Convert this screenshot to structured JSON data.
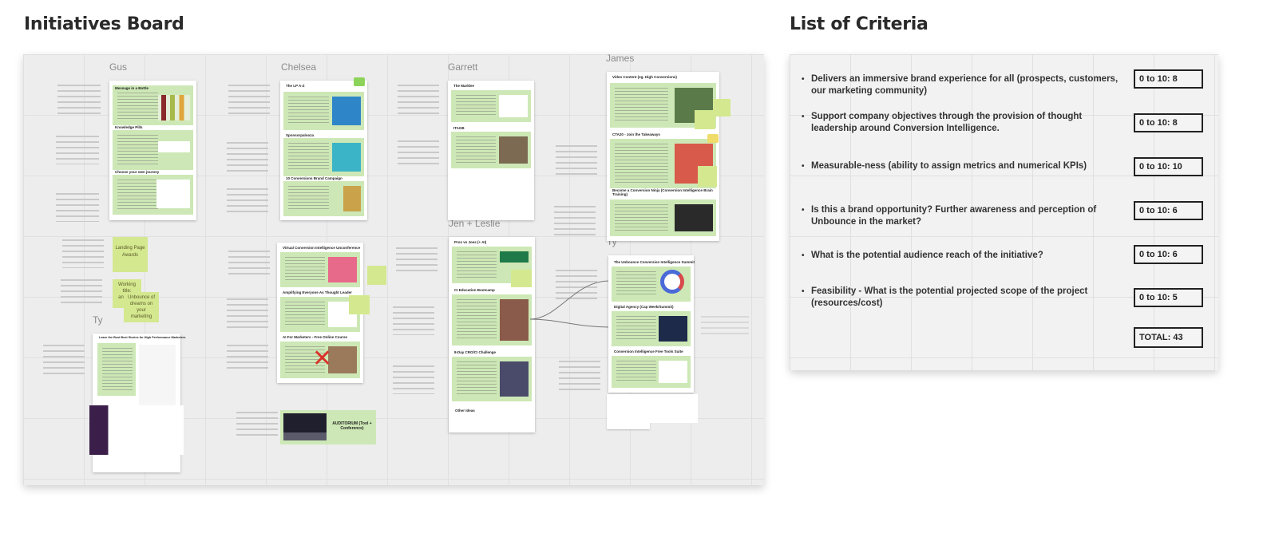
{
  "headings": {
    "left": "Initiatives Board",
    "right": "List of Criteria"
  },
  "board": {
    "columns": {
      "gus": "Gus",
      "chelsea": "Chelsea",
      "garrett": "Garrett",
      "james": "James",
      "ty_left": "Ty",
      "jen_leslie": "Jen + Leslie",
      "ty_right": "Ty"
    },
    "frames": {
      "gus": [
        "Message in a Bottle",
        "Knowledge Pills",
        "Choose your own journey"
      ],
      "chelsea": [
        "The LP A-Z",
        "Sponsorpalooza",
        "10 Conversions Brand Campaign"
      ],
      "garrett": [
        "The Marklee",
        "ITAGB"
      ],
      "james": [
        "Video Content (eg. High Conversions)",
        "CTA20 - Join the Takeaways",
        "Become a Conversion Ninja (Conversion Intelligence Brain Training)"
      ],
      "chelsea2": [
        "Virtual Conversion Intelligence Unconference",
        "Amplifying Everyone As Thought Leader",
        "AI For Marketers - Free Online Course"
      ],
      "jen_leslie": [
        "Pros vs Joes (+ AI)",
        "CI Education Bootcamp",
        "8-Day CRO/CI Challenge",
        "Other Ideas"
      ],
      "ty_right": [
        "The Unbounce Conversion Intelligence Summit",
        "Digital Agency (Cap Week/Summit)",
        "Conversion Intelligence Free Tools Suite"
      ],
      "ty_left": [
        "Learn the Best Best Stories for High Performance Marketers"
      ]
    },
    "stickies": {
      "landing_page_awards": "Landing Page Awards",
      "working_title": "Working title: analysis",
      "unbounce_dreams": "Unbounce of dreams on your marketing",
      "auditorium": "AUDITORIUM (Tool + Conference)"
    }
  },
  "criteria": [
    {
      "text": "Delivers an immersive brand experience for all (prospects, customers, our marketing community)",
      "score": "0 to 10: 8"
    },
    {
      "text": "Support company objectives through the provision of thought leadership around Conversion Intelligence.",
      "score": "0 to 10: 8"
    },
    {
      "text": "Measurable-ness (ability to assign metrics and numerical KPIs)",
      "score": "0 to 10: 10"
    },
    {
      "text": "Is this a brand opportunity? Further awareness and perception of Unbounce in the market?",
      "score": "0 to 10: 6"
    },
    {
      "text": "What is the potential audience reach of the initiative?",
      "score": "0 to 10: 6"
    },
    {
      "text": "Feasibility - What is the potential projected scope of the project (resources/cost)",
      "score": "0 to 10: 5"
    }
  ],
  "total": "TOTAL: 43",
  "colors": {
    "card_green": "#cde8b6",
    "sticky_yellow": "#d4e88f",
    "red_x": "#d9332b"
  }
}
